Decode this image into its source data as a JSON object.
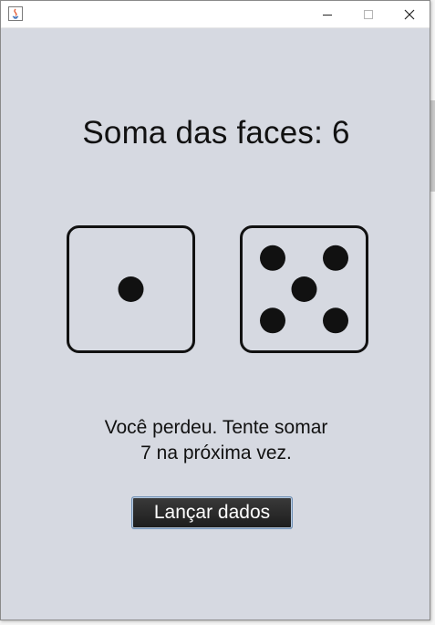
{
  "window": {
    "title": "",
    "icon": "java-app-icon",
    "controls": [
      "minimize-icon",
      "maximize-icon",
      "close-icon"
    ]
  },
  "game": {
    "sum_text": "Soma das faces: 6",
    "die_left": {
      "face": 1
    },
    "die_right": {
      "face": 5
    },
    "message_line1": "Você perdeu. Tente somar",
    "message_line2": "7 na próxima vez.",
    "roll_button_label": "Lançar dados"
  },
  "colors": {
    "background": "#d6d9e1",
    "pip": "#111111",
    "button_bg": "#2a2a2a",
    "button_text": "#ffffff"
  }
}
